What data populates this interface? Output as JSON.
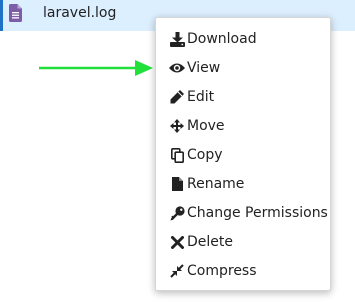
{
  "file": {
    "name": "laravel.log",
    "icon": "file-text-icon"
  },
  "annotation": {
    "arrow_color": "#22e03a",
    "icon": "arrow-right-icon"
  },
  "context_menu": {
    "items": [
      {
        "label": "Download",
        "icon": "download-icon"
      },
      {
        "label": "View",
        "icon": "eye-icon"
      },
      {
        "label": "Edit",
        "icon": "pencil-icon"
      },
      {
        "label": "Move",
        "icon": "move-icon"
      },
      {
        "label": "Copy",
        "icon": "copy-icon"
      },
      {
        "label": "Rename",
        "icon": "file-icon"
      },
      {
        "label": "Change Permissions",
        "icon": "key-icon"
      },
      {
        "label": "Delete",
        "icon": "close-icon"
      },
      {
        "label": "Compress",
        "icon": "compress-icon"
      }
    ]
  },
  "colors": {
    "selected_row_bg": "#dcefff",
    "selected_row_border": "#1f73c7",
    "file_icon": "#7b5ea7"
  }
}
